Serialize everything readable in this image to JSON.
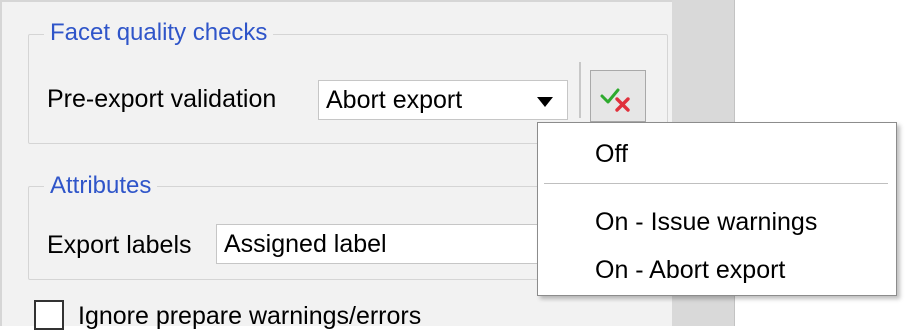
{
  "facet_group": {
    "title": "Facet quality checks",
    "validation_label": "Pre-export validation",
    "validation_value": "Abort export",
    "validate_icon": "check-cross-icon"
  },
  "attributes_group": {
    "title": "Attributes",
    "export_labels_label": "Export labels",
    "export_labels_value": "Assigned label"
  },
  "ignore_checkbox": {
    "label": "Ignore prepare warnings/errors",
    "checked": false
  },
  "dropdown_menu": {
    "items": [
      "Off",
      "On - Issue warnings",
      "On - Abort export"
    ]
  },
  "colors": {
    "group_title": "#2f55c9",
    "check_green": "#2eaa2e",
    "cross_red": "#e0303b"
  }
}
